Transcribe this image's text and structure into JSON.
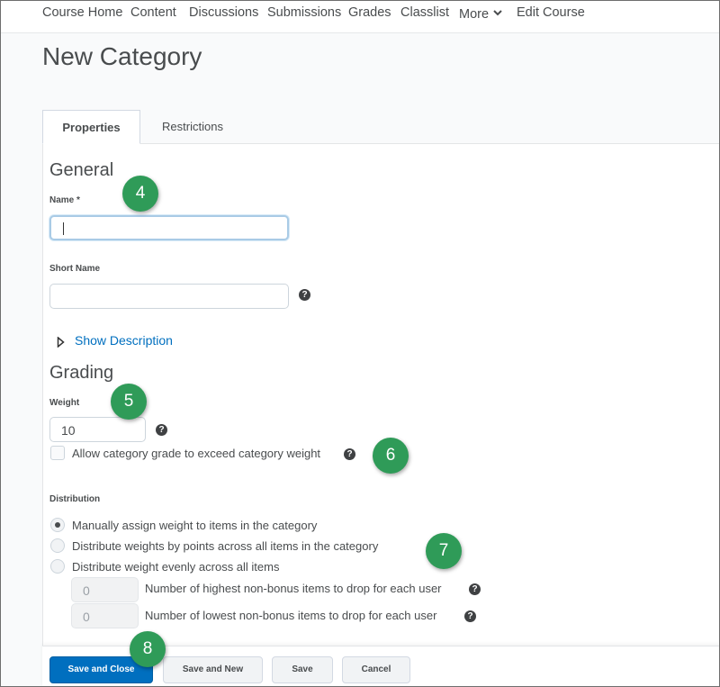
{
  "nav": {
    "items": [
      "Course Home",
      "Content",
      "Discussions",
      "Submissions",
      "Grades",
      "Classlist",
      "More",
      "Edit Course"
    ]
  },
  "page": {
    "title": "New Category"
  },
  "tabs": [
    {
      "label": "Properties",
      "active": true
    },
    {
      "label": "Restrictions",
      "active": false
    }
  ],
  "general": {
    "heading": "General",
    "name_label": "Name *",
    "name_value": "",
    "short_name_label": "Short Name",
    "short_name_value": "",
    "show_description": "Show Description"
  },
  "grading": {
    "heading": "Grading",
    "weight_label": "Weight",
    "weight_value": "10",
    "exceed_label": "Allow category grade to exceed category weight",
    "exceed_checked": false
  },
  "distribution": {
    "label": "Distribution",
    "options": [
      {
        "label": "Manually assign weight to items in the category",
        "checked": true
      },
      {
        "label": "Distribute weights by points across all items in the category",
        "checked": false
      },
      {
        "label": "Distribute weight evenly across all items",
        "checked": false
      }
    ],
    "drop_highest_value": "0",
    "drop_highest_label": "Number of highest non-bonus items to drop for each user",
    "drop_lowest_value": "0",
    "drop_lowest_label": "Number of lowest non-bonus items to drop for each user"
  },
  "callouts": [
    "4",
    "5",
    "6",
    "7",
    "8"
  ],
  "footer": {
    "save_close": "Save and Close",
    "save_new": "Save and New",
    "save": "Save",
    "cancel": "Cancel"
  },
  "colors": {
    "primary": "#006fbf",
    "callout": "#2f9b58",
    "link": "#006fbf"
  }
}
